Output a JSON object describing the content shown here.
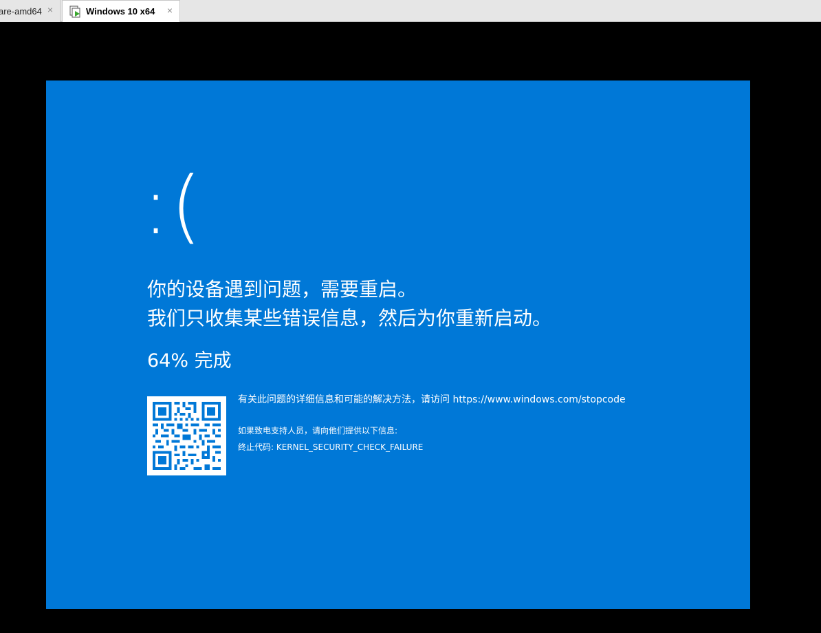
{
  "tabs": [
    {
      "label": "are-amd64",
      "active": false,
      "close": "×"
    },
    {
      "label": "Windows 10 x64",
      "active": true,
      "close": "×"
    }
  ],
  "bsod": {
    "face": ":(",
    "line1": "你的设备遇到问题，需要重启。",
    "line2": "我们只收集某些错误信息，然后为你重新启动。",
    "progress": "64% 完成",
    "info_text": "有关此问题的详细信息和可能的解决方法，请访问 https://www.windows.com/stopcode",
    "support_text": "如果致电支持人员，请向他们提供以下信息:",
    "stop_code": "终止代码: KERNEL_SECURITY_CHECK_FAILURE",
    "background_color": "#0078d7"
  },
  "icons": {
    "vm": "vm-running-icon",
    "qr": "qr-code-icon"
  }
}
